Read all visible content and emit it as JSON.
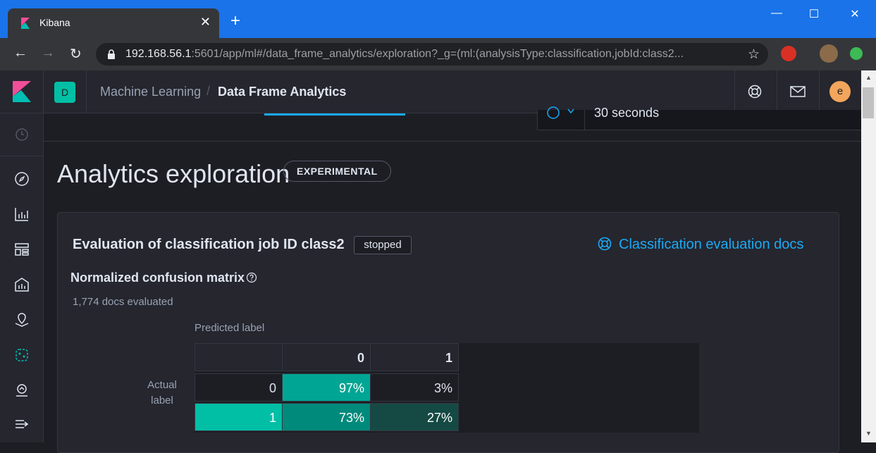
{
  "browser": {
    "tab_title": "Kibana",
    "tab_close": "✕",
    "new_tab": "+",
    "url_host": "192.168.56.1",
    "url_rest": ":5601/app/ml#/data_frame_analytics/exploration?_g=(ml:(analysisType:classification,jobId:class2...",
    "window_controls": {
      "minimize": "—",
      "maximize": "☐",
      "close": "✕"
    }
  },
  "header": {
    "space_initial": "D",
    "breadcrumbs": [
      "Machine Learning",
      "Data Frame Analytics"
    ],
    "breadcrumb_separator": "/",
    "user_initial": "e"
  },
  "strip": {
    "refresh_text": "30 seconds"
  },
  "nav": {
    "icons": [
      "clock-icon",
      "compass-icon",
      "visualize-icon",
      "dashboard-icon",
      "canvas-icon",
      "maps-icon",
      "ml-icon",
      "metrics-icon",
      "collapse-icon"
    ]
  },
  "page": {
    "title": "Analytics exploration",
    "badge": "EXPERIMENTAL"
  },
  "evaluation": {
    "title": "Evaluation of classification job ID class2",
    "status": "stopped",
    "docs_link": "Classification evaluation docs",
    "matrix_title": "Normalized confusion matrix",
    "docs_evaluated": "1,774 docs evaluated",
    "predicted_label": "Predicted label",
    "actual_label": "Actual label"
  },
  "matrix": {
    "columns": [
      "",
      "0",
      "1"
    ],
    "rows": [
      {
        "label": "0",
        "values": [
          "97%",
          "3%"
        ]
      },
      {
        "label": "1",
        "values": [
          "73%",
          "27%"
        ]
      }
    ]
  },
  "colors": {
    "accent": "#1ba9f5",
    "teal": "#00bfa5",
    "cell_97": "#00a693",
    "cell_73": "#008a7b",
    "cell_27": "#154a44"
  }
}
